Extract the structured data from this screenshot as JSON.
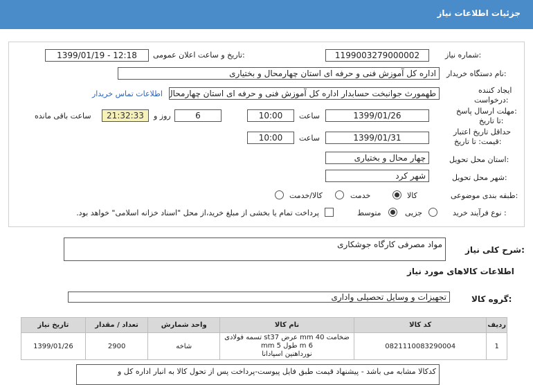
{
  "header": {
    "title": "جزئیات اطلاعات نیاز"
  },
  "fields": {
    "need_number_label": "شماره نیاز:",
    "need_number": "1199003279000002",
    "announce_label": "تاریخ و ساعت اعلان عمومی:",
    "announce_value": "1399/01/19 - 12:18",
    "buyer_label": "نام دستگاه خریدار:",
    "buyer_value": "اداره کل آموزش فنی و حرفه ای استان چهارمحال و بختیاری",
    "creator_label_1": "ایجاد کننده",
    "creator_label_2": "درخواست:",
    "creator_value": "طهمورث جوانبخت حسابدار اداره کل آموزش فنی و حرفه ای استان چهارمحال و",
    "contact_link": "اطلاعات تماس خریدار",
    "deadline_label_1": "مهلت ارسال پاسخ:",
    "deadline_label_2": "تا تاریخ:",
    "deadline_date": "1399/01/26",
    "time_label": "ساعت",
    "deadline_time": "10:00",
    "day_label": "روز و",
    "days": "6",
    "remaining_time": "21:32:33",
    "remaining_label": "ساعت باقی مانده",
    "validity_label_1": "حداقل تاریخ اعتبار",
    "validity_label_2": "قیمت: تا تاریخ:",
    "validity_date": "1399/01/31",
    "validity_time": "10:00",
    "province_label": "استان محل تحویل:",
    "province_value": "چهار محال و بختیاری",
    "city_label": "شهر محل تحویل:",
    "city_value": "شهر کرد",
    "category_label": "طبقه بندی موضوعی:",
    "category_goods": "کالا",
    "category_service": "خدمت",
    "category_both": "کالا/خدمت",
    "purchase_label": "نوع فرآیند خرید :",
    "purchase_partial": "جزیی",
    "purchase_medium": "متوسط",
    "payment_note": "پرداخت تمام یا بخشی از مبلغ خرید،از محل \"اسناد خزانه اسلامی\" خواهد بود."
  },
  "summary": {
    "label": "شرح کلی نیاز:",
    "value": "مواد مصرفی کارگاه جوشکاری"
  },
  "goods_section": {
    "title": "اطلاعات کالاهای مورد نیاز"
  },
  "group": {
    "label": "گروه کالا:",
    "value": "تجهیزات و وسایل تحصیلی واداری"
  },
  "table": {
    "headers": [
      "ردیف",
      "کد کالا",
      "نام کالا",
      "واحد شمارش",
      "تعداد / مقدار",
      "تاریخ نیاز"
    ],
    "rows": [
      {
        "row": "1",
        "code": "0821110083290004",
        "name_line1": "تسمه فولادی st37 عرض mm 40 ضخامت mm 5 طول m 6",
        "name_line2": "نورداهنین اسپادانا",
        "unit": "شاخه",
        "qty": "2900",
        "date": "1399/01/26"
      }
    ]
  },
  "note": {
    "text": "کدکالا مشابه می باشد - پیشنهاد قیمت طبق فایل پیوست-پرداخت پس از تحول کالا به انبار اداره کل و"
  },
  "colors": {
    "header_bg": "#4a8cc9",
    "link": "#2b62b8",
    "timer_bg": "#f6f1b9"
  }
}
